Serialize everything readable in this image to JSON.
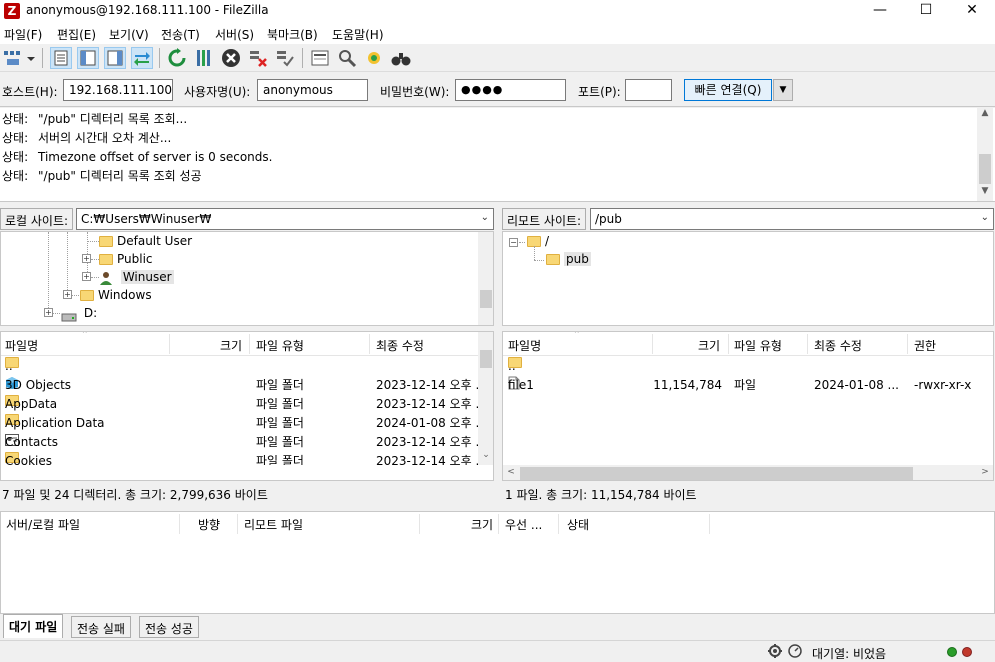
{
  "window": {
    "title": "anonymous@192.168.111.100 - FileZilla",
    "app_icon": "Z"
  },
  "menu": [
    {
      "label": "파일(F)"
    },
    {
      "label": "편집(E)"
    },
    {
      "label": "보기(V)"
    },
    {
      "label": "전송(T)"
    },
    {
      "label": "서버(S)"
    },
    {
      "label": "북마크(B)"
    },
    {
      "label": "도움말(H)"
    }
  ],
  "quickconnect": {
    "host_label": "호스트(H):",
    "host_value": "192.168.111.100",
    "user_label": "사용자명(U):",
    "user_value": "anonymous",
    "pass_label": "비밀번호(W):",
    "pass_value": "●●●●",
    "port_label": "포트(P):",
    "port_value": "",
    "connect_label": "빠른 연결(Q)",
    "dropdown_icon": "▼"
  },
  "log": [
    {
      "k": "상태:",
      "msg": "\"/pub\" 디렉터리 목록 조회..."
    },
    {
      "k": "상태:",
      "msg": "서버의 시간대 오차 계산..."
    },
    {
      "k": "상태:",
      "msg": "Timezone offset of server is 0 seconds."
    },
    {
      "k": "상태:",
      "msg": "\"/pub\" 디렉터리 목록 조회 성공"
    }
  ],
  "local": {
    "site_label": "로컬 사이트:",
    "path": "C:₩Users₩Winuser₩",
    "tree": [
      {
        "label": "Default User"
      },
      {
        "label": "Public"
      },
      {
        "label": "Winuser"
      },
      {
        "label": "Windows"
      },
      {
        "label": "D:"
      }
    ],
    "columns": {
      "name": "파일명",
      "size": "크기",
      "type": "파일 유형",
      "modified": "최종 수정"
    },
    "files": [
      {
        "name": "..",
        "size": "",
        "type": "",
        "modified": ""
      },
      {
        "name": "3D Objects",
        "size": "",
        "type": "파일 폴더",
        "modified": "2023-12-14 오후 ..."
      },
      {
        "name": "AppData",
        "size": "",
        "type": "파일 폴더",
        "modified": "2023-12-14 오후 ..."
      },
      {
        "name": "Application Data",
        "size": "",
        "type": "파일 폴더",
        "modified": "2024-01-08 오후 ..."
      },
      {
        "name": "Contacts",
        "size": "",
        "type": "파일 폴더",
        "modified": "2023-12-14 오후 ..."
      },
      {
        "name": "Cookies",
        "size": "",
        "type": "파일 폴더",
        "modified": "2023-12-14 오후 ..."
      }
    ],
    "status": "7 파일 및 24 디렉터리. 총 크기: 2,799,636 바이트"
  },
  "remote": {
    "site_label": "리모트 사이트:",
    "path": "/pub",
    "tree": [
      {
        "label": "/"
      },
      {
        "label": "pub"
      }
    ],
    "columns": {
      "name": "파일명",
      "size": "크기",
      "type": "파일 유형",
      "modified": "최종 수정",
      "perm": "권한"
    },
    "files": [
      {
        "name": "..",
        "size": "",
        "type": "",
        "modified": "",
        "perm": ""
      },
      {
        "name": "file1",
        "size": "11,154,784",
        "type": "파일",
        "modified": "2024-01-08 ...",
        "perm": "-rwxr-xr-x"
      }
    ],
    "status": "1 파일. 총 크기: 11,154,784 바이트"
  },
  "queue": {
    "columns": {
      "file": "서버/로컬 파일",
      "dir": "방향",
      "remote": "리모트 파일",
      "size": "크기",
      "prio": "우선 ...",
      "status": "상태"
    }
  },
  "tabs": [
    {
      "label": "대기 파일"
    },
    {
      "label": "전송 실패"
    },
    {
      "label": "전송 성공"
    }
  ],
  "statusbar": {
    "queue_label": "대기열: 비었음"
  },
  "colors": {
    "accent": "#0078d7",
    "folder": "#f8d775",
    "led_green": "#2a9d2a",
    "led_red": "#c0392b"
  }
}
